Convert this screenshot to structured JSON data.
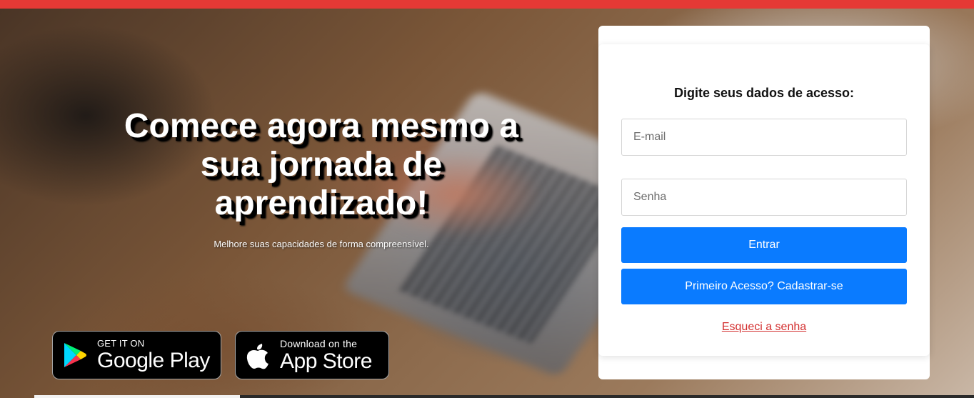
{
  "hero": {
    "headline": "Comece agora mesmo a sua jornada de aprendizado!",
    "subheadline": "Melhore suas capacidades de forma compreensível."
  },
  "stores": {
    "google_play": {
      "small": "GET IT ON",
      "big": "Google Play",
      "icon": "google-play-icon"
    },
    "app_store": {
      "small": "Download on the",
      "big": "App Store",
      "icon": "apple-icon"
    }
  },
  "login": {
    "title": "Digite seus dados de acesso:",
    "email_placeholder": "E-mail",
    "email_value": "",
    "password_placeholder": "Senha",
    "password_value": "",
    "login_button": "Entrar",
    "register_button": "Primeiro Acesso? Cadastrar-se",
    "forgot_link": "Esqueci a senha"
  },
  "colors": {
    "top_bar": "#e53935",
    "primary_button": "#0a7bff",
    "link": "#d32f2f"
  }
}
